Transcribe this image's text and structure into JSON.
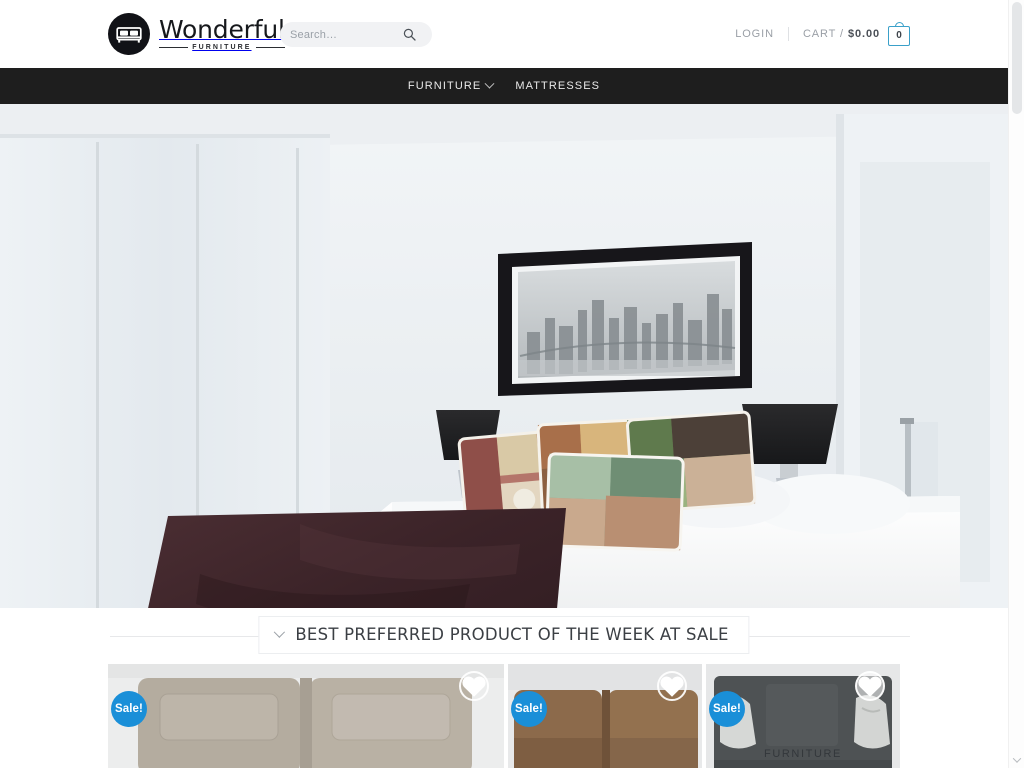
{
  "header": {
    "brand": {
      "name": "Wonderful",
      "subtitle": "FURNITURE",
      "logo_icon": "bed-icon"
    },
    "search": {
      "placeholder": "Search…",
      "value": "",
      "icon": "search-icon"
    },
    "login_label": "LOGIN",
    "cart_label": "CART /",
    "cart_amount": "$0.00",
    "cart_count": "0",
    "cart_icon": "shopping-bag-icon"
  },
  "nav": {
    "items": [
      {
        "label": "FURNITURE",
        "has_dropdown": true,
        "caret_icon": "chevron-down-icon"
      },
      {
        "label": "MATTRESSES",
        "has_dropdown": false
      }
    ]
  },
  "hero": {
    "alt": "Modern white bedroom with double bed, colourful patterned cushions, dark brown throw, black bedside lamps and framed black-and-white city skyline artwork",
    "accent": "#dfe4e8"
  },
  "section": {
    "title": "BEST PREFERRED PRODUCT OF THE WEEK AT SALE",
    "caret_icon": "chevron-down-icon"
  },
  "products": [
    {
      "name": "grey-leather-sofa",
      "badge": "Sale!",
      "wishlist_icon": "heart-icon",
      "wishlist_active": false,
      "caption": ""
    },
    {
      "name": "brown-fabric-sofa",
      "badge": "Sale!",
      "wishlist_icon": "heart-icon",
      "wishlist_active": false,
      "caption": ""
    },
    {
      "name": "charcoal-sofa-with-cushions",
      "badge": "Sale!",
      "wishlist_icon": "heart-icon",
      "wishlist_active": true,
      "caption": "FURNITURE"
    }
  ],
  "colors": {
    "nav_bg": "#1e1e1e",
    "sale_badge": "#1a8fd8",
    "cart_accent": "#3aa0c9",
    "muted_text": "#9a9fa6"
  }
}
